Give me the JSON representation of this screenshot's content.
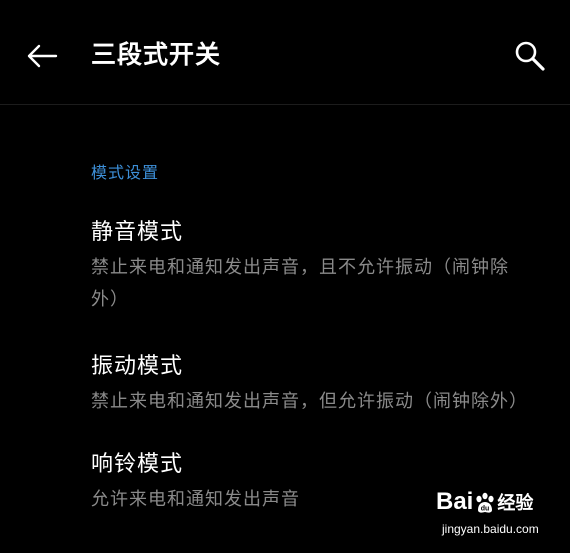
{
  "header": {
    "title": "三段式开关",
    "back_icon": "arrow-left-icon",
    "search_icon": "search-icon"
  },
  "section": {
    "label": "模式设置",
    "accent_color": "#3d8fd8"
  },
  "options": [
    {
      "title": "静音模式",
      "description": "禁止来电和通知发出声音，且不允许振动（闹钟除外）"
    },
    {
      "title": "振动模式",
      "description": "禁止来电和通知发出声音，但允许振动（闹钟除外）"
    },
    {
      "title": "响铃模式",
      "description": "允许来电和通知发出声音"
    }
  ],
  "watermark": {
    "brand_left": "Bai",
    "brand_right": "经验",
    "domain": "jingyan.baidu.com"
  },
  "colors": {
    "background": "#000000",
    "primary_text": "#ffffff",
    "secondary_text": "#8a8a8a"
  }
}
